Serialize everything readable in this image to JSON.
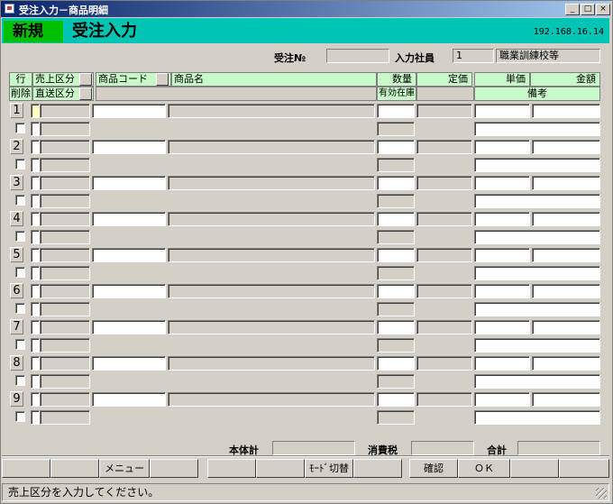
{
  "window": {
    "title": "受注入力－商品明細",
    "min_glyph": "_",
    "max_glyph": "□",
    "close_glyph": "×"
  },
  "banner": {
    "mode": "新規",
    "title": "受注入力",
    "ip": "192.168.16.14"
  },
  "header": {
    "order_no_label": "受注№",
    "order_no_value": "",
    "staff_label": "入力社員",
    "staff_code": "1",
    "staff_name": "職業訓練校等"
  },
  "columns": {
    "line": "行",
    "sales_type": "売上区分",
    "product_code": "商品コード",
    "product_name": "商品名",
    "quantity": "数量",
    "list_price": "定価",
    "unit_price": "単価",
    "amount": "金額",
    "delete": "削除",
    "direct_ship": "直送区分",
    "stock": "有効在庫",
    "remarks": "備考"
  },
  "rows": [
    "1",
    "2",
    "3",
    "4",
    "5",
    "6",
    "7",
    "8",
    "9"
  ],
  "footer": {
    "subtotal_label": "本体計",
    "subtotal_value": "",
    "tax_label": "消費税",
    "tax_value": "",
    "total_label": "合計",
    "total_value": ""
  },
  "function_keys": [
    "",
    "",
    "メニュー",
    "",
    "",
    "",
    "ﾓｰﾄﾞ切替",
    "",
    "確認",
    "ＯＫ",
    "",
    ""
  ],
  "status": {
    "message": "売上区分を入力してください。"
  }
}
